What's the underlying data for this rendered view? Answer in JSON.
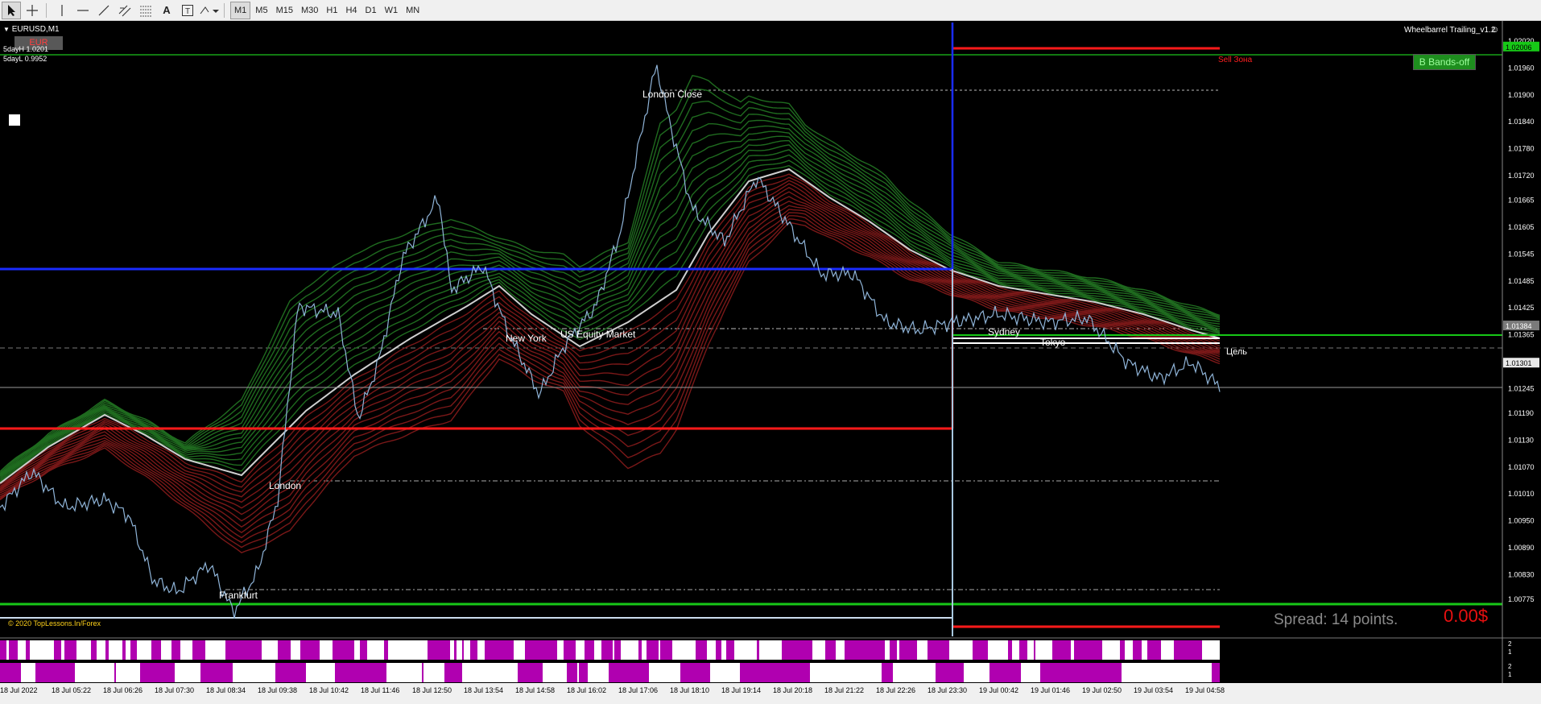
{
  "toolbar": {
    "tools": [
      "cursor-icon",
      "crosshair-icon",
      "vertical-line-icon",
      "horizontal-line-icon",
      "trendline-icon",
      "equidistant-channel-icon",
      "fibonacci-icon",
      "text-icon",
      "text-label-icon",
      "shapes-icon"
    ],
    "timeframes": [
      "M1",
      "M5",
      "M15",
      "M30",
      "H1",
      "H4",
      "D1",
      "W1",
      "MN"
    ],
    "active_timeframe": "M1"
  },
  "chart": {
    "symbol": "EURUSD,M1",
    "tag": "EUR",
    "sday_high": "5dayH 1.0201",
    "sday_low": "5dayL 0.9952",
    "indicator_name": "Wheelbarrel Trailing_v1.2",
    "copyright": "© 2020 TopLessons.In/Forex",
    "sell_zone": "Sell Зона",
    "target": "Цель",
    "bands_button": "B Bands-off",
    "spread": "Spread: 14 points.",
    "profit": "0.00$",
    "sessions": {
      "london_close": "London Close",
      "new_york": "New York",
      "us_equity": "US Equity Market",
      "london": "London",
      "frankfurt": "Frankfurt",
      "sydney": "Sydney",
      "tokyo": "Tokyo"
    },
    "price_axis": [
      "1.02020",
      "1.01960",
      "1.01900",
      "1.01840",
      "1.01780",
      "1.01720",
      "1.01665",
      "1.01605",
      "1.01545",
      "1.01485",
      "1.01425",
      "1.01365",
      "1.01305",
      "1.01245",
      "1.01190",
      "1.01130",
      "1.01070",
      "1.01010",
      "1.00950",
      "1.00890",
      "1.00830",
      "1.00775"
    ],
    "current_price": "1.02006",
    "level_price": "1.01384",
    "bid_price": "1.01301",
    "time_axis": [
      "18 Jul 2022",
      "18 Jul 05:22",
      "18 Jul 06:26",
      "18 Jul 07:30",
      "18 Jul 08:34",
      "18 Jul 09:38",
      "18 Jul 10:42",
      "18 Jul 11:46",
      "18 Jul 12:50",
      "18 Jul 13:54",
      "18 Jul 14:58",
      "18 Jul 16:02",
      "18 Jul 17:06",
      "18 Jul 18:10",
      "18 Jul 19:14",
      "18 Jul 20:18",
      "18 Jul 21:22",
      "18 Jul 22:26",
      "18 Jul 23:30",
      "19 Jul 00:42",
      "19 Jul 01:46",
      "19 Jul 02:50",
      "19 Jul 03:54",
      "19 Jul 04:58"
    ],
    "sub_window_scale": [
      "2",
      "1"
    ],
    "colors": {
      "bull_band": "#1f6b1f",
      "bear_band": "#7a1818",
      "ma_line": "#cfcfcf",
      "price": "#8fb4d8",
      "blue_level": "#1a2cff",
      "red_level": "#ff1a1a",
      "green_level": "#17c817",
      "magenta": "#b000b0"
    }
  }
}
